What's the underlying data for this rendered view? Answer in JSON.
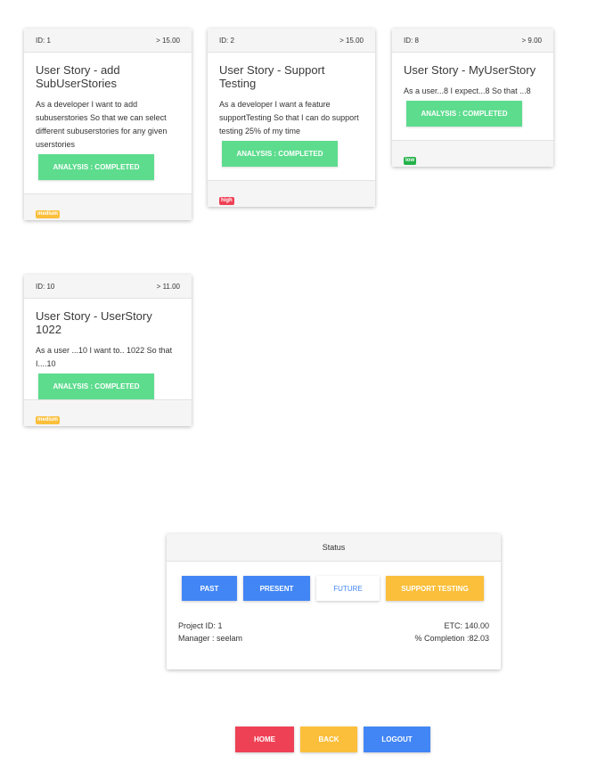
{
  "cards": [
    {
      "id": "ID: 1",
      "estimate": "> 15.00",
      "title": "User Story - add SubUserStories",
      "description": "As a developer I want to add subuserstories So that we can select different subuserstories for any given userstories",
      "status": "ANALYSIS : COMPLETED",
      "priority": "medium"
    },
    {
      "id": "ID: 2",
      "estimate": "> 15.00",
      "title": "User Story - Support Testing",
      "description": "As a developer I want a feature supportTesting So that I can do support testing 25% of my time",
      "status": "ANALYSIS : COMPLETED",
      "priority": "high"
    },
    {
      "id": "ID: 8",
      "estimate": "> 9.00",
      "title": "User Story - MyUserStory",
      "description": "As a user...8 I expect...8 So that ...8",
      "status": "ANALYSIS : COMPLETED",
      "priority": "low"
    },
    {
      "id": "ID: 10",
      "estimate": "> 11.00",
      "title": "User Story - UserStory 1022",
      "description": "As a user ...10 I want to.. 1022 So that I....10",
      "status": "ANALYSIS : COMPLETED",
      "priority": "medium"
    }
  ],
  "status_panel": {
    "title": "Status",
    "buttons": {
      "past": "PAST",
      "present": "PRESENT",
      "future": "FUTURE",
      "support": "SUPPORT TESTING"
    },
    "project_id": "Project ID: 1",
    "manager": "Manager : seelam",
    "etc": "ETC: 140.00",
    "completion": "% Completion :82.03"
  },
  "nav": {
    "home": "HOME",
    "back": "BACK",
    "logout": "LOGOUT"
  },
  "colors": {
    "primary": "#4286f5",
    "success": "#5ddc8e",
    "warning": "#fbbf3b",
    "danger": "#ef4155",
    "low": "#25b24a"
  }
}
